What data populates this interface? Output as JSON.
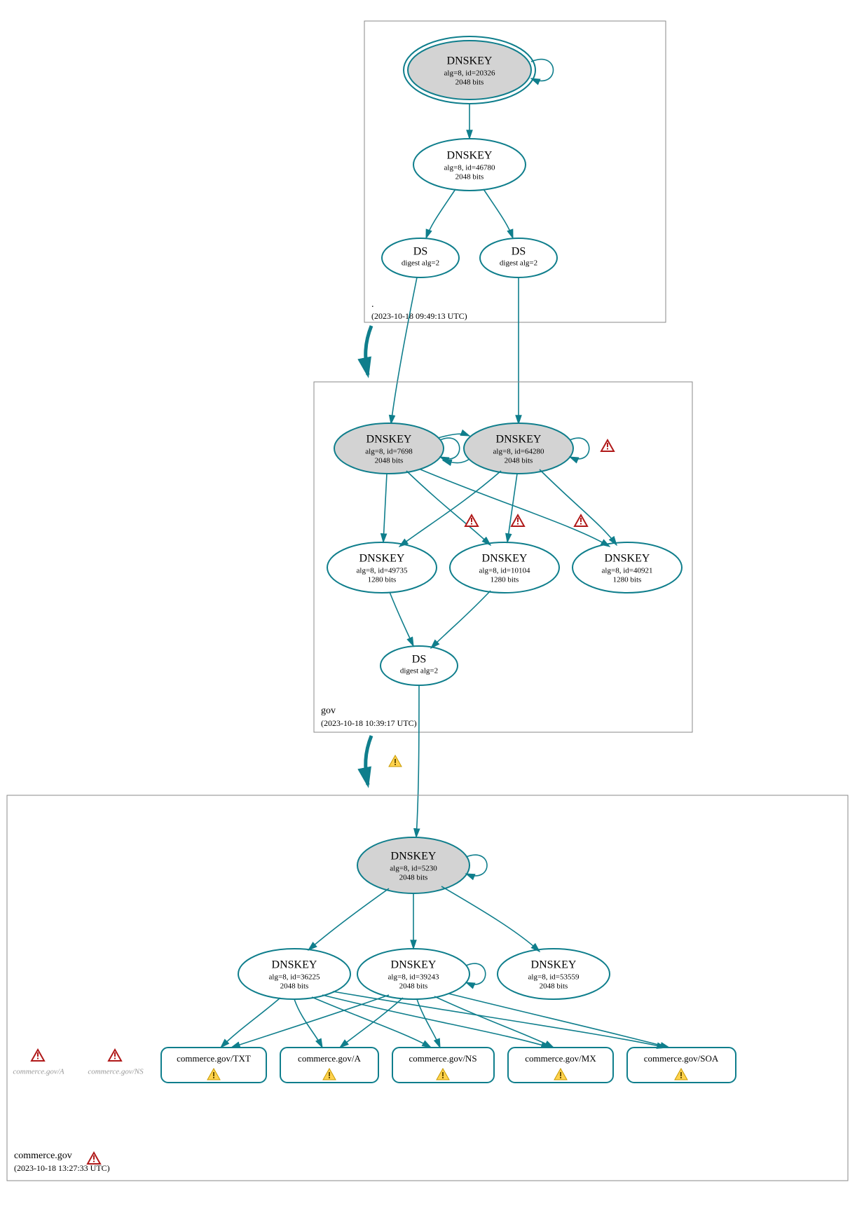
{
  "zones": [
    {
      "name": ".",
      "time": "(2023-10-18 09:49:13 UTC)"
    },
    {
      "name": "gov",
      "time": "(2023-10-18 10:39:17 UTC)"
    },
    {
      "name": "commerce.gov",
      "time": "(2023-10-18 13:27:33 UTC)"
    }
  ],
  "nodes": {
    "n_root_ksk": {
      "t": "DNSKEY",
      "l1": "alg=8, id=20326",
      "l2": "2048 bits"
    },
    "n_root_zsk": {
      "t": "DNSKEY",
      "l1": "alg=8, id=46780",
      "l2": "2048 bits"
    },
    "n_root_ds1": {
      "t": "DS",
      "l1": "digest alg=2",
      "l2": ""
    },
    "n_root_ds2": {
      "t": "DS",
      "l1": "digest alg=2",
      "l2": ""
    },
    "n_gov_7698": {
      "t": "DNSKEY",
      "l1": "alg=8, id=7698",
      "l2": "2048 bits"
    },
    "n_gov_64280": {
      "t": "DNSKEY",
      "l1": "alg=8, id=64280",
      "l2": "2048 bits"
    },
    "n_gov_49735": {
      "t": "DNSKEY",
      "l1": "alg=8, id=49735",
      "l2": "1280 bits"
    },
    "n_gov_10104": {
      "t": "DNSKEY",
      "l1": "alg=8, id=10104",
      "l2": "1280 bits"
    },
    "n_gov_40921": {
      "t": "DNSKEY",
      "l1": "alg=8, id=40921",
      "l2": "1280 bits"
    },
    "n_gov_ds": {
      "t": "DS",
      "l1": "digest alg=2",
      "l2": ""
    },
    "n_com_5230": {
      "t": "DNSKEY",
      "l1": "alg=8, id=5230",
      "l2": "2048 bits"
    },
    "n_com_36225": {
      "t": "DNSKEY",
      "l1": "alg=8, id=36225",
      "l2": "2048 bits"
    },
    "n_com_39243": {
      "t": "DNSKEY",
      "l1": "alg=8, id=39243",
      "l2": "2048 bits"
    },
    "n_com_53559": {
      "t": "DNSKEY",
      "l1": "alg=8, id=53559",
      "l2": "2048 bits"
    }
  },
  "rrsets": {
    "r_txt": "commerce.gov/TXT",
    "r_a": "commerce.gov/A",
    "r_ns": "commerce.gov/NS",
    "r_mx": "commerce.gov/MX",
    "r_soa": "commerce.gov/SOA"
  },
  "ghosts": {
    "g_a": "commerce.gov/A",
    "g_ns": "commerce.gov/NS"
  }
}
